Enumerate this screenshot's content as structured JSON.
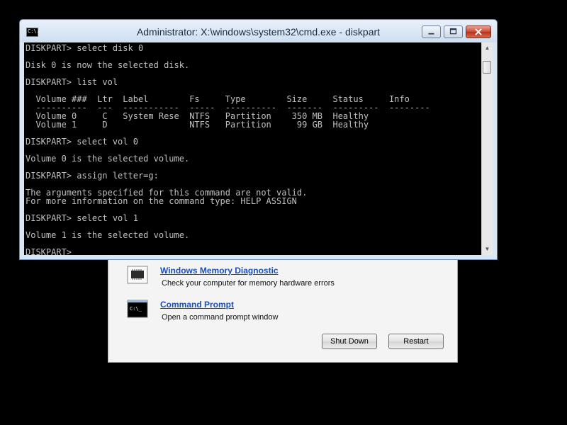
{
  "cmd": {
    "title": "Administrator: X:\\windows\\system32\\cmd.exe - diskpart",
    "icon_text": "C:\\.",
    "lines": [
      "DISKPART> select disk 0",
      "",
      "Disk 0 is now the selected disk.",
      "",
      "DISKPART> list vol",
      "",
      "  Volume ###  Ltr  Label        Fs     Type        Size     Status     Info",
      "  ----------  ---  -----------  -----  ----------  -------  ---------  --------",
      "  Volume 0     C   System Rese  NTFS   Partition    350 MB  Healthy",
      "  Volume 1     D                NTFS   Partition     99 GB  Healthy",
      "",
      "DISKPART> select vol 0",
      "",
      "Volume 0 is the selected volume.",
      "",
      "DISKPART> assign letter=g:",
      "",
      "The arguments specified for this command are not valid.",
      "For more information on the command type: HELP ASSIGN",
      "",
      "DISKPART> select vol 1",
      "",
      "Volume 1 is the selected volume.",
      "",
      "DISKPART> "
    ],
    "icons": {
      "minimize": "minimize-icon",
      "maximize": "maximize-icon",
      "close": "close-icon"
    }
  },
  "recovery": {
    "tools": [
      {
        "name": "Windows Memory Diagnostic",
        "description": "Check your computer for memory hardware errors",
        "icon": "memory-chip-icon"
      },
      {
        "name": "Command Prompt",
        "description": "Open a command prompt window",
        "icon": "command-prompt-icon"
      }
    ],
    "buttons": {
      "shutdown": "Shut Down",
      "restart": "Restart"
    }
  }
}
